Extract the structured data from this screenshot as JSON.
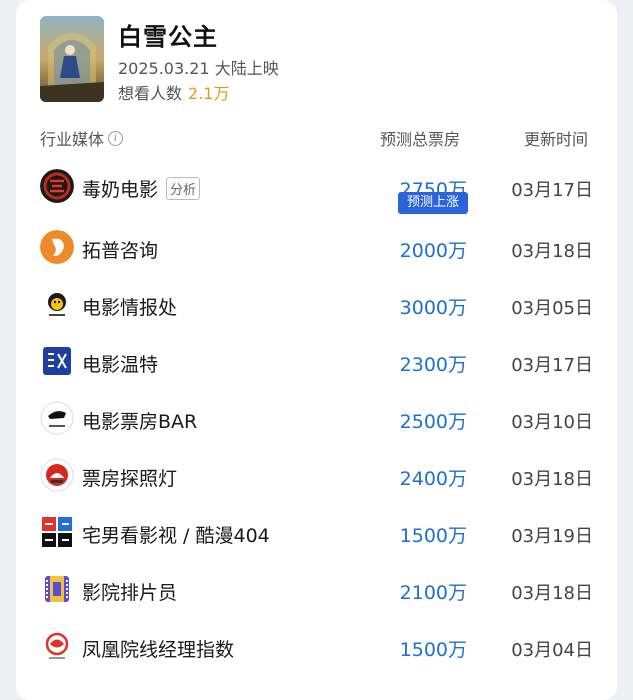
{
  "movie": {
    "title": "白雪公主",
    "release": "2025.03.21 大陆上映",
    "want_label": "想看人数",
    "want_count": "2.1万"
  },
  "headers": {
    "media": "行业媒体",
    "box": "预测总票房",
    "date": "更新时间"
  },
  "rows": [
    {
      "name": "毒奶电影",
      "tag": "分析",
      "box": "2750万",
      "badge": "预测上涨",
      "date": "03月17日",
      "logo": "dunai-logo-icon"
    },
    {
      "name": "拓普咨询",
      "box": "2000万",
      "date": "03月18日",
      "logo": "tuopu-logo-icon"
    },
    {
      "name": "电影情报处",
      "box": "3000万",
      "date": "03月05日",
      "logo": "qingbaochu-logo-icon"
    },
    {
      "name": "电影温特",
      "box": "2300万",
      "date": "03月17日",
      "logo": "wente-logo-icon"
    },
    {
      "name": "电影票房BAR",
      "box": "2500万",
      "date": "03月10日",
      "logo": "piaofangbar-logo-icon"
    },
    {
      "name": "票房探照灯",
      "box": "2400万",
      "date": "03月18日",
      "logo": "tanzhaodeng-logo-icon"
    },
    {
      "name": "宅男看影视 / 酷漫404",
      "box": "1500万",
      "date": "03月19日",
      "logo": "zhainan-logo-icon"
    },
    {
      "name": "影院排片员",
      "box": "2100万",
      "date": "03月18日",
      "logo": "paipianyuan-logo-icon"
    },
    {
      "name": "凤凰院线经理指数",
      "box": "1500万",
      "date": "03月04日",
      "logo": "fenghuang-logo-icon"
    }
  ],
  "colors": {
    "accent_blue": "#1e6fd0",
    "badge_blue": "#2a64d8",
    "orange": "#e89a12"
  }
}
